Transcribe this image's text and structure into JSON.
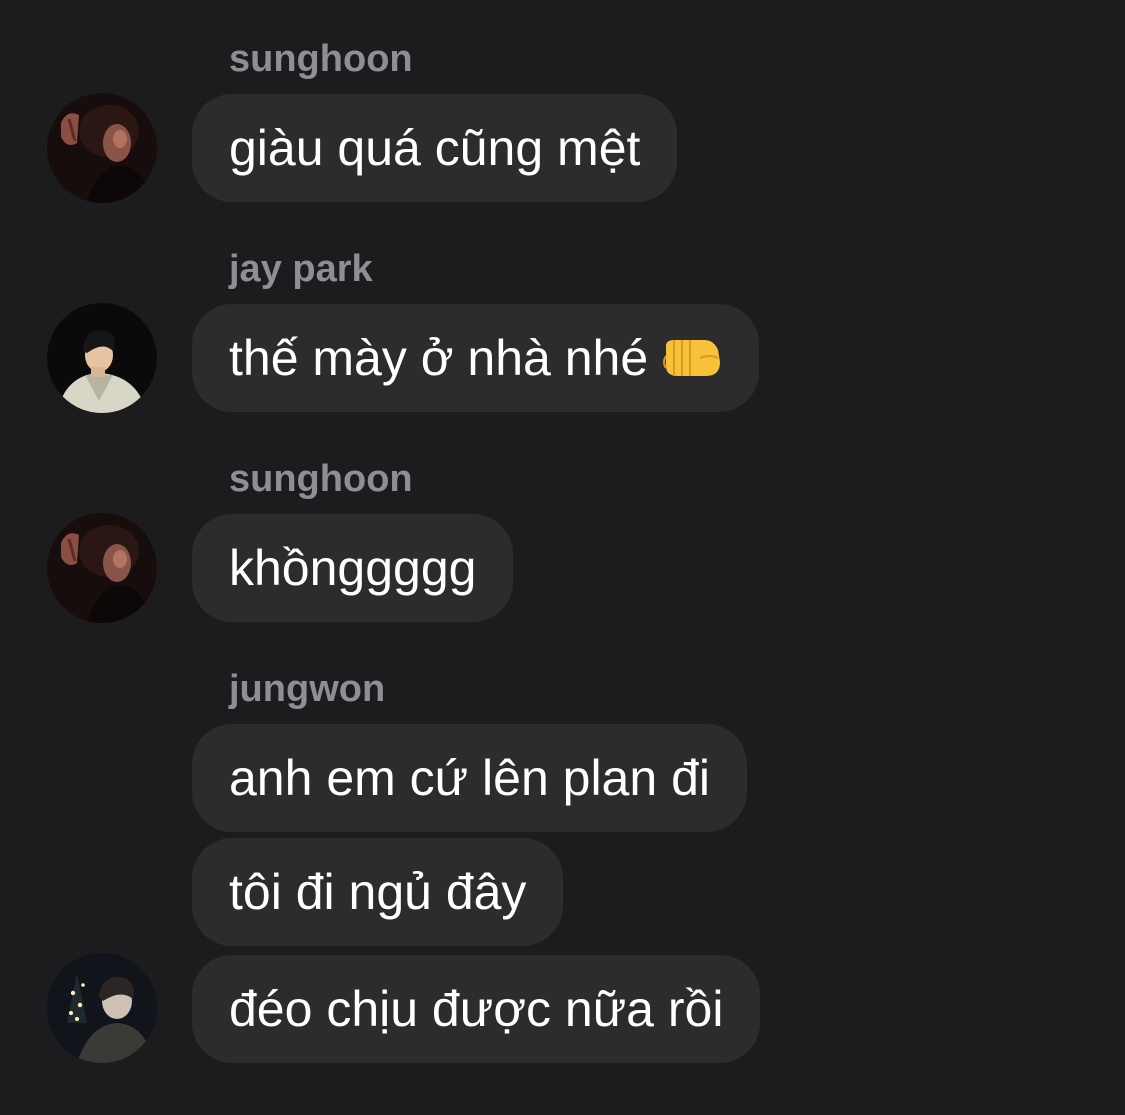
{
  "chat": {
    "groups": [
      {
        "sender": "sunghoon",
        "messages": [
          "giàu quá cũng mệt"
        ]
      },
      {
        "sender": "jay park",
        "messages": [
          "thế mày ở nhà nhé"
        ],
        "emoji": "left-facing-fist"
      },
      {
        "sender": "sunghoon",
        "messages": [
          "khồnggggg"
        ]
      },
      {
        "sender": "jungwon",
        "messages": [
          "anh em cứ lên plan đi",
          "tôi đi ngủ đây",
          "đéo chịu được nữa rồi"
        ]
      }
    ]
  },
  "colors": {
    "background": "#1c1c1e",
    "bubble": "#2c2c2e",
    "sender_name": "#8e8e93",
    "message_text": "#ffffff"
  }
}
